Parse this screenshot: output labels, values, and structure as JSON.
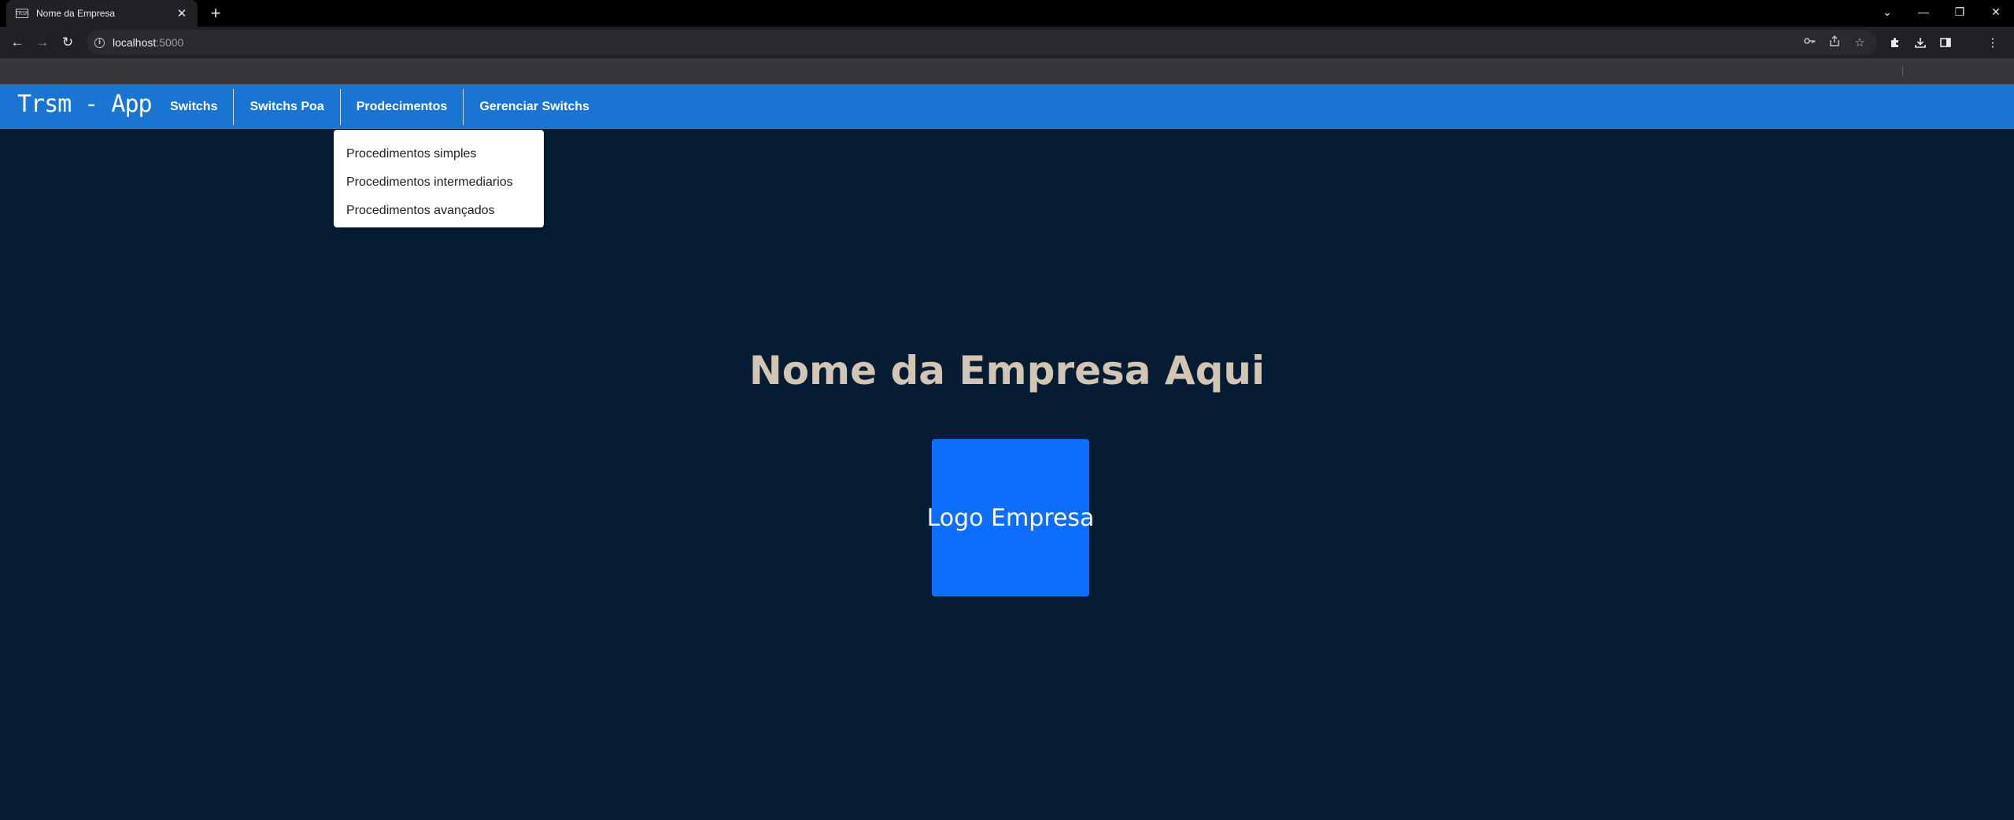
{
  "browser": {
    "tab": {
      "favicon_text": "TRSM",
      "title": "Nome da Empresa",
      "close_symbol": "✕"
    },
    "new_tab_symbol": "+",
    "window_controls": {
      "tab_search": "⌄",
      "minimize": "—",
      "restore": "❐",
      "close": "✕"
    },
    "nav": {
      "back": "←",
      "forward": "→",
      "reload": "↻"
    },
    "address": {
      "host": "localhost",
      "port": ":5000"
    },
    "omnibox_icons": [
      "key-icon",
      "share-icon",
      "star-icon"
    ],
    "extension_icons": [
      "puzzle-icon",
      "download-icon",
      "side-panel-icon",
      "kebab-menu-icon"
    ]
  },
  "navbar": {
    "brand": "Trsm - App",
    "items": [
      {
        "label": "Switchs"
      },
      {
        "label": "Switchs Poa"
      },
      {
        "label": "Prodecimentos"
      },
      {
        "label": "Gerenciar Switchs"
      }
    ]
  },
  "dropdown": {
    "items": [
      {
        "label": "Procedimentos simples"
      },
      {
        "label": "Procedimentos intermediarios"
      },
      {
        "label": "Procedimentos avançados"
      }
    ]
  },
  "main": {
    "headline": "Nome da Empresa Aqui",
    "logo_placeholder": "Logo Empresa"
  },
  "colors": {
    "navbar_bg": "#1a75d2",
    "page_bg": "#051c33",
    "headline": "#d2c5b4",
    "logo_bg": "#0d6efd"
  }
}
